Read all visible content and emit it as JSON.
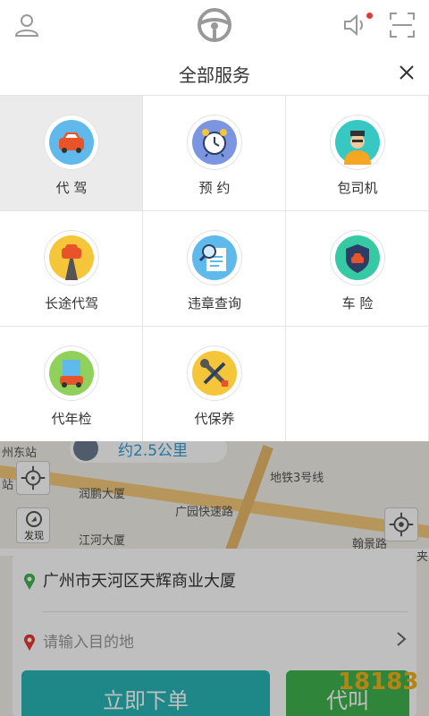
{
  "header": {
    "title": "全部服务"
  },
  "services": [
    {
      "label": "代 驾",
      "icon": "car-icon",
      "color": "#5fb9ea"
    },
    {
      "label": "预 约",
      "icon": "alarm-clock-icon",
      "color": "#7c95e0"
    },
    {
      "label": "包司机",
      "icon": "chauffeur-icon",
      "color": "#37c8c4"
    },
    {
      "label": "长途代驾",
      "icon": "long-road-car-icon",
      "color": "#f5c53a"
    },
    {
      "label": "违章查询",
      "icon": "magnifier-document-icon",
      "color": "#5fb9ea"
    },
    {
      "label": "车 险",
      "icon": "shield-car-icon",
      "color": "#37c8a4"
    },
    {
      "label": "代年检",
      "icon": "inspection-car-icon",
      "color": "#8fd15a"
    },
    {
      "label": "代保养",
      "icon": "wrench-screwdriver-icon",
      "color": "#f5c53a"
    }
  ],
  "map": {
    "distance": "约2.5公里",
    "labels": [
      "州东站",
      "站",
      "润鹏大厦",
      "江河大厦",
      "广园快速路",
      "地铁3号线",
      "翰景路",
      "夹"
    ],
    "find_label": "发现"
  },
  "order": {
    "origin": "广州市天河区天辉商业大厦",
    "destination_placeholder": "请输入目的地",
    "primary_button": "立即下单",
    "secondary_button": "代叫"
  },
  "watermark": "18183",
  "colors": {
    "accent": "#29b6b6",
    "green": "#3fb34f",
    "badge": "#e53935"
  }
}
